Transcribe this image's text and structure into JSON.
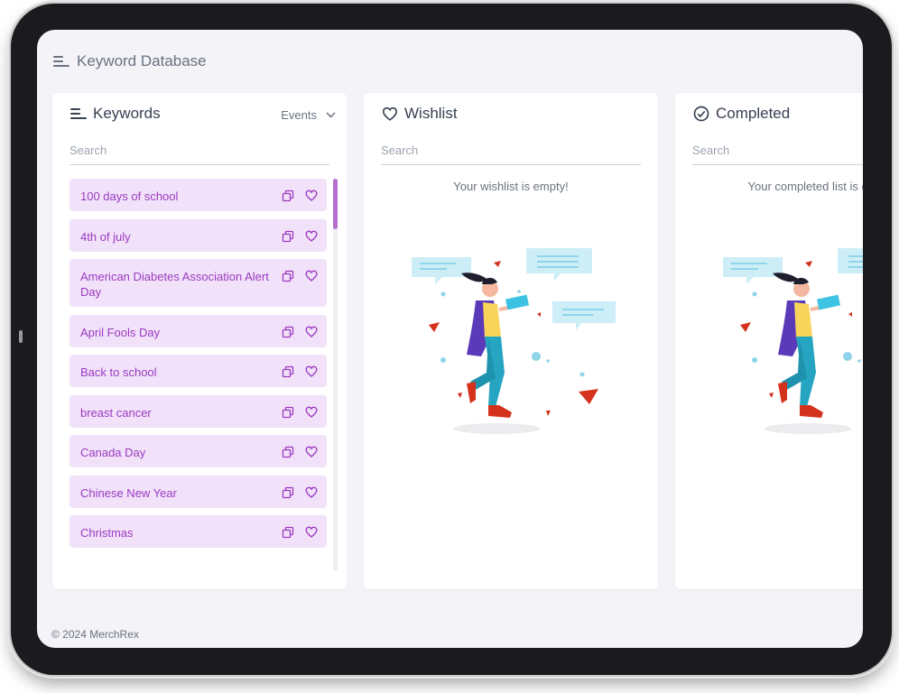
{
  "page": {
    "title": "Keyword Database"
  },
  "keywords_panel": {
    "title": "Keywords",
    "filter_label": "Events",
    "search_placeholder": "Search",
    "items": [
      {
        "label": "100 days of school"
      },
      {
        "label": "4th of july"
      },
      {
        "label": "American Diabetes Association Alert Day"
      },
      {
        "label": "April Fools Day"
      },
      {
        "label": "Back to school"
      },
      {
        "label": "breast cancer"
      },
      {
        "label": "Canada Day"
      },
      {
        "label": "Chinese New Year"
      },
      {
        "label": "Christmas"
      }
    ],
    "scroll_position": 0
  },
  "wishlist_panel": {
    "title": "Wishlist",
    "search_placeholder": "Search",
    "empty_message": "Your wishlist is empty!"
  },
  "completed_panel": {
    "title": "Completed",
    "search_placeholder": "Search",
    "empty_message": "Your completed list is empty!"
  },
  "footer": {
    "copyright": "© 2024 MerchRex"
  },
  "colors": {
    "accent": "#9b3bc1",
    "item_background": "#f1e1f9",
    "scroll_thumb": "#b770cf",
    "screen_background": "#f3f3f8"
  },
  "icons": {
    "header": "menu-lines-icon",
    "wishlist": "heart-icon",
    "completed": "check-circle-icon",
    "item_copy": "copy-icon",
    "item_wishlist": "heart-icon",
    "filter": "chevron-down-icon"
  }
}
